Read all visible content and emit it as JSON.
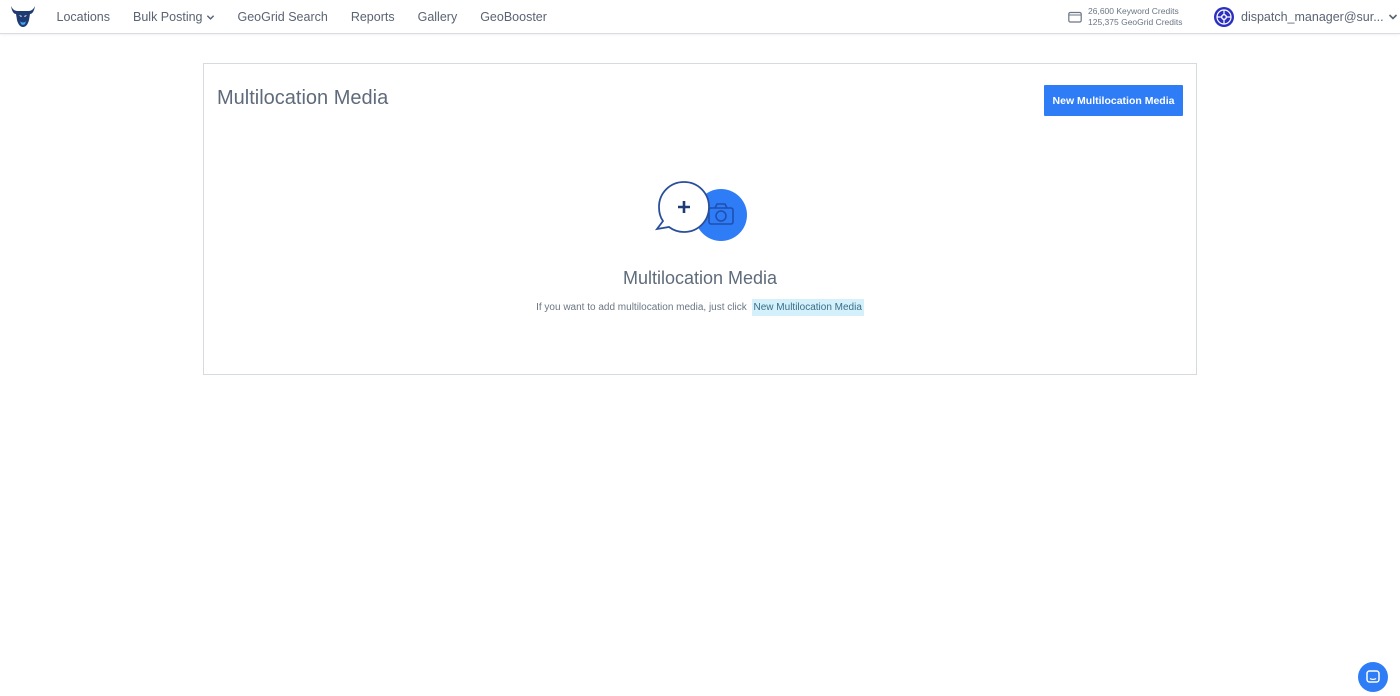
{
  "nav": {
    "links": [
      {
        "label": "Locations"
      },
      {
        "label": "Bulk Posting"
      },
      {
        "label": "GeoGrid Search"
      },
      {
        "label": "Reports"
      },
      {
        "label": "Gallery"
      },
      {
        "label": "GeoBooster"
      }
    ],
    "credits": {
      "keyword": "26,600 Keyword Credits",
      "geogrid": "125,375 GeoGrid Credits"
    },
    "user": {
      "name": "dispatch_manager@sur..."
    }
  },
  "main": {
    "title": "Multilocation Media",
    "new_button_label": "New Multilocation Media",
    "empty_state": {
      "title": "Multilocation Media",
      "help_text": "If you want to add multilocation media, just click",
      "help_link": "New Multilocation Media"
    }
  },
  "colors": {
    "accent": "#2f7df6",
    "highlight_bg": "#d3f0fb",
    "text": "#5f6b7a"
  },
  "icons": {
    "logo": "bull-logo-icon",
    "wallet": "wallet-icon",
    "avatar": "globe-avatar-icon",
    "chat": "chat-bubble-icon"
  }
}
